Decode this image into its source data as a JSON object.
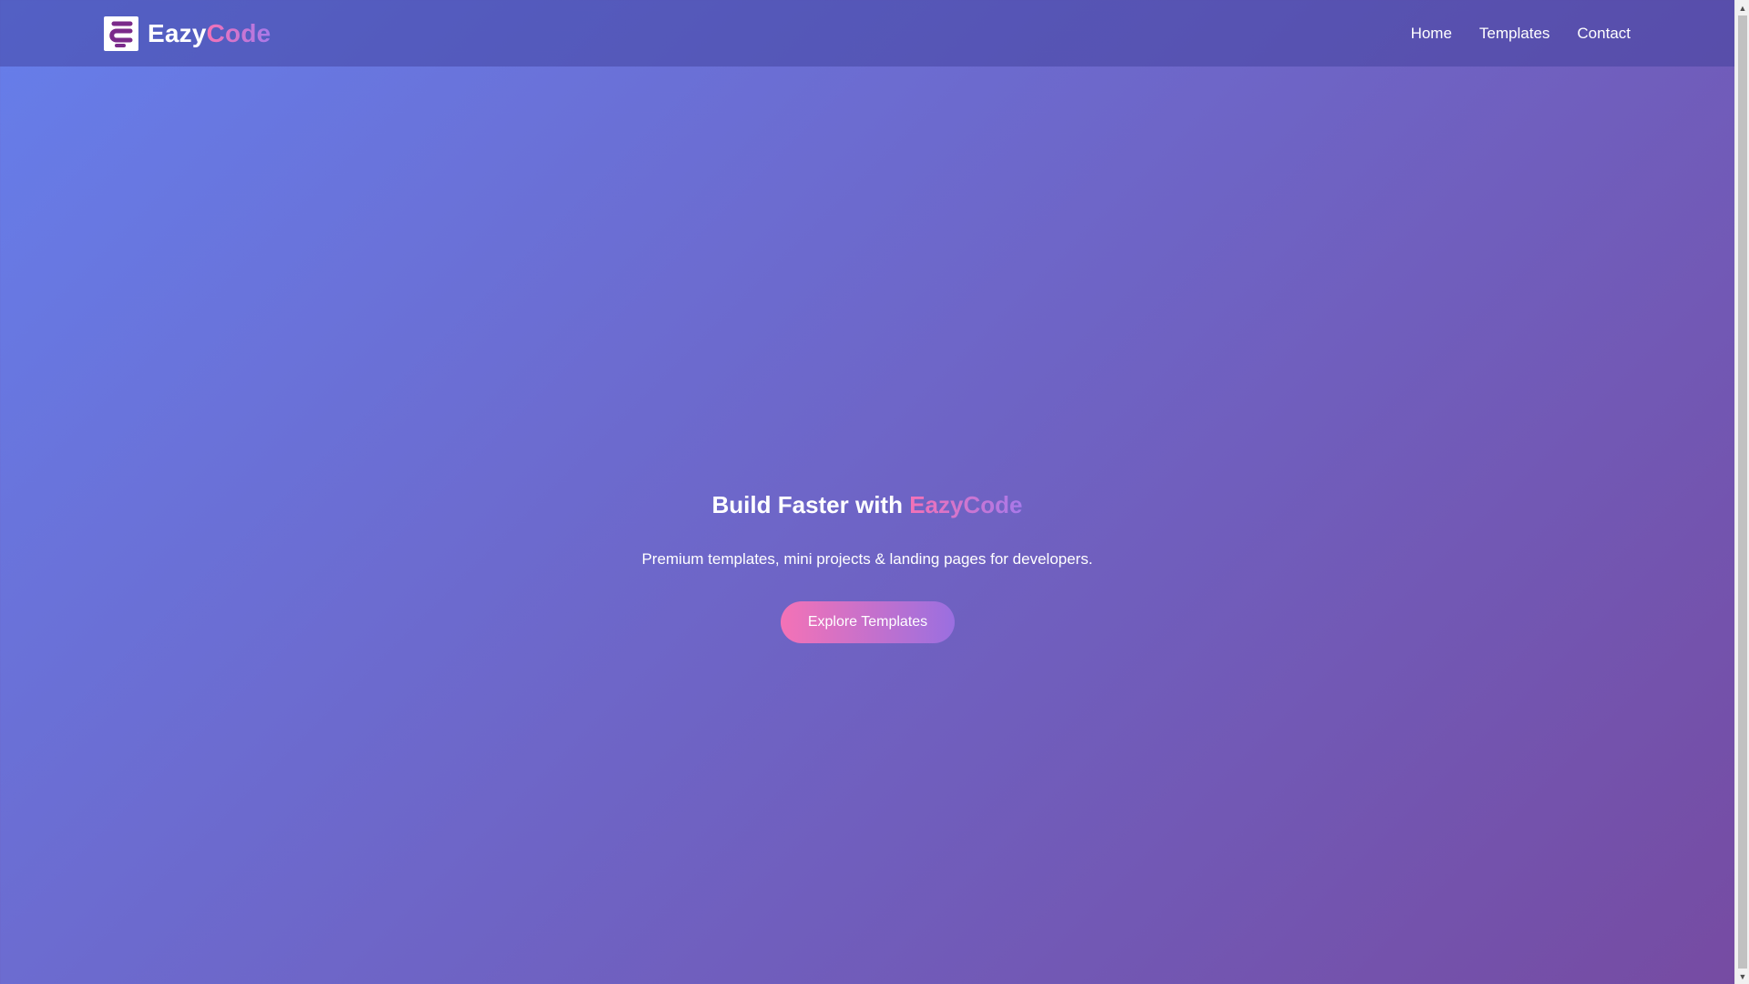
{
  "navbar": {
    "brand_primary": "Eazy",
    "brand_accent": "Code",
    "links": [
      {
        "label": "Home"
      },
      {
        "label": "Templates"
      },
      {
        "label": "Contact"
      }
    ]
  },
  "hero": {
    "title_prefix": "Build Faster with ",
    "title_accent": "EazyCode",
    "subtitle": "Premium templates, mini projects & landing pages for developers.",
    "cta_label": "Explore Templates"
  },
  "colors": {
    "gradient_start": "#667eea",
    "gradient_end": "#764ba2",
    "accent_pink": "#f472b6",
    "accent_purple": "#a879ea"
  },
  "icons": {
    "logo": "eazycode-logo-icon",
    "scroll_up": "arrow-up-icon",
    "scroll_down": "arrow-down-icon"
  }
}
